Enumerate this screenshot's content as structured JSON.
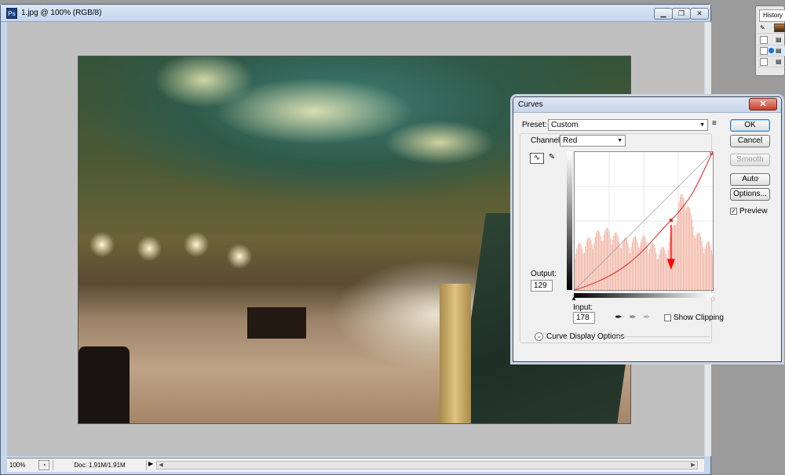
{
  "document": {
    "title": "1.jpg @ 100% (RGB/8)",
    "app_icon": "Ps",
    "zoom": "100%",
    "doc_info": "Doc: 1.91M/1.91M",
    "window_buttons": {
      "minimize": "▁",
      "restore": "❐",
      "close": "✕"
    }
  },
  "history_panel": {
    "tab_label": "History"
  },
  "curves": {
    "title": "Curves",
    "close_label": "✕",
    "preset_label": "Preset:",
    "preset_value": "Custom",
    "preset_menu_icon": "≡",
    "channel_label": "Channel:",
    "channel_value": "Red",
    "output_label": "Output:",
    "output_value": "129",
    "input_label": "Input:",
    "input_value": "178",
    "show_clipping_label": "Show Clipping",
    "show_clipping_checked": false,
    "display_options_label": "Curve Display Options",
    "preview_label": "Preview",
    "preview_checked": true,
    "buttons": {
      "ok": "OK",
      "cancel": "Cancel",
      "smooth": "Smooth",
      "auto": "Auto",
      "options": "Options..."
    },
    "colors": {
      "curve": "#e02020",
      "histogram": "#f2b4a4",
      "arrow": "#ff0000"
    },
    "curve_points": [
      [
        0,
        0
      ],
      [
        178,
        129
      ],
      [
        255,
        255
      ]
    ],
    "selected_point": [
      178,
      129
    ]
  }
}
